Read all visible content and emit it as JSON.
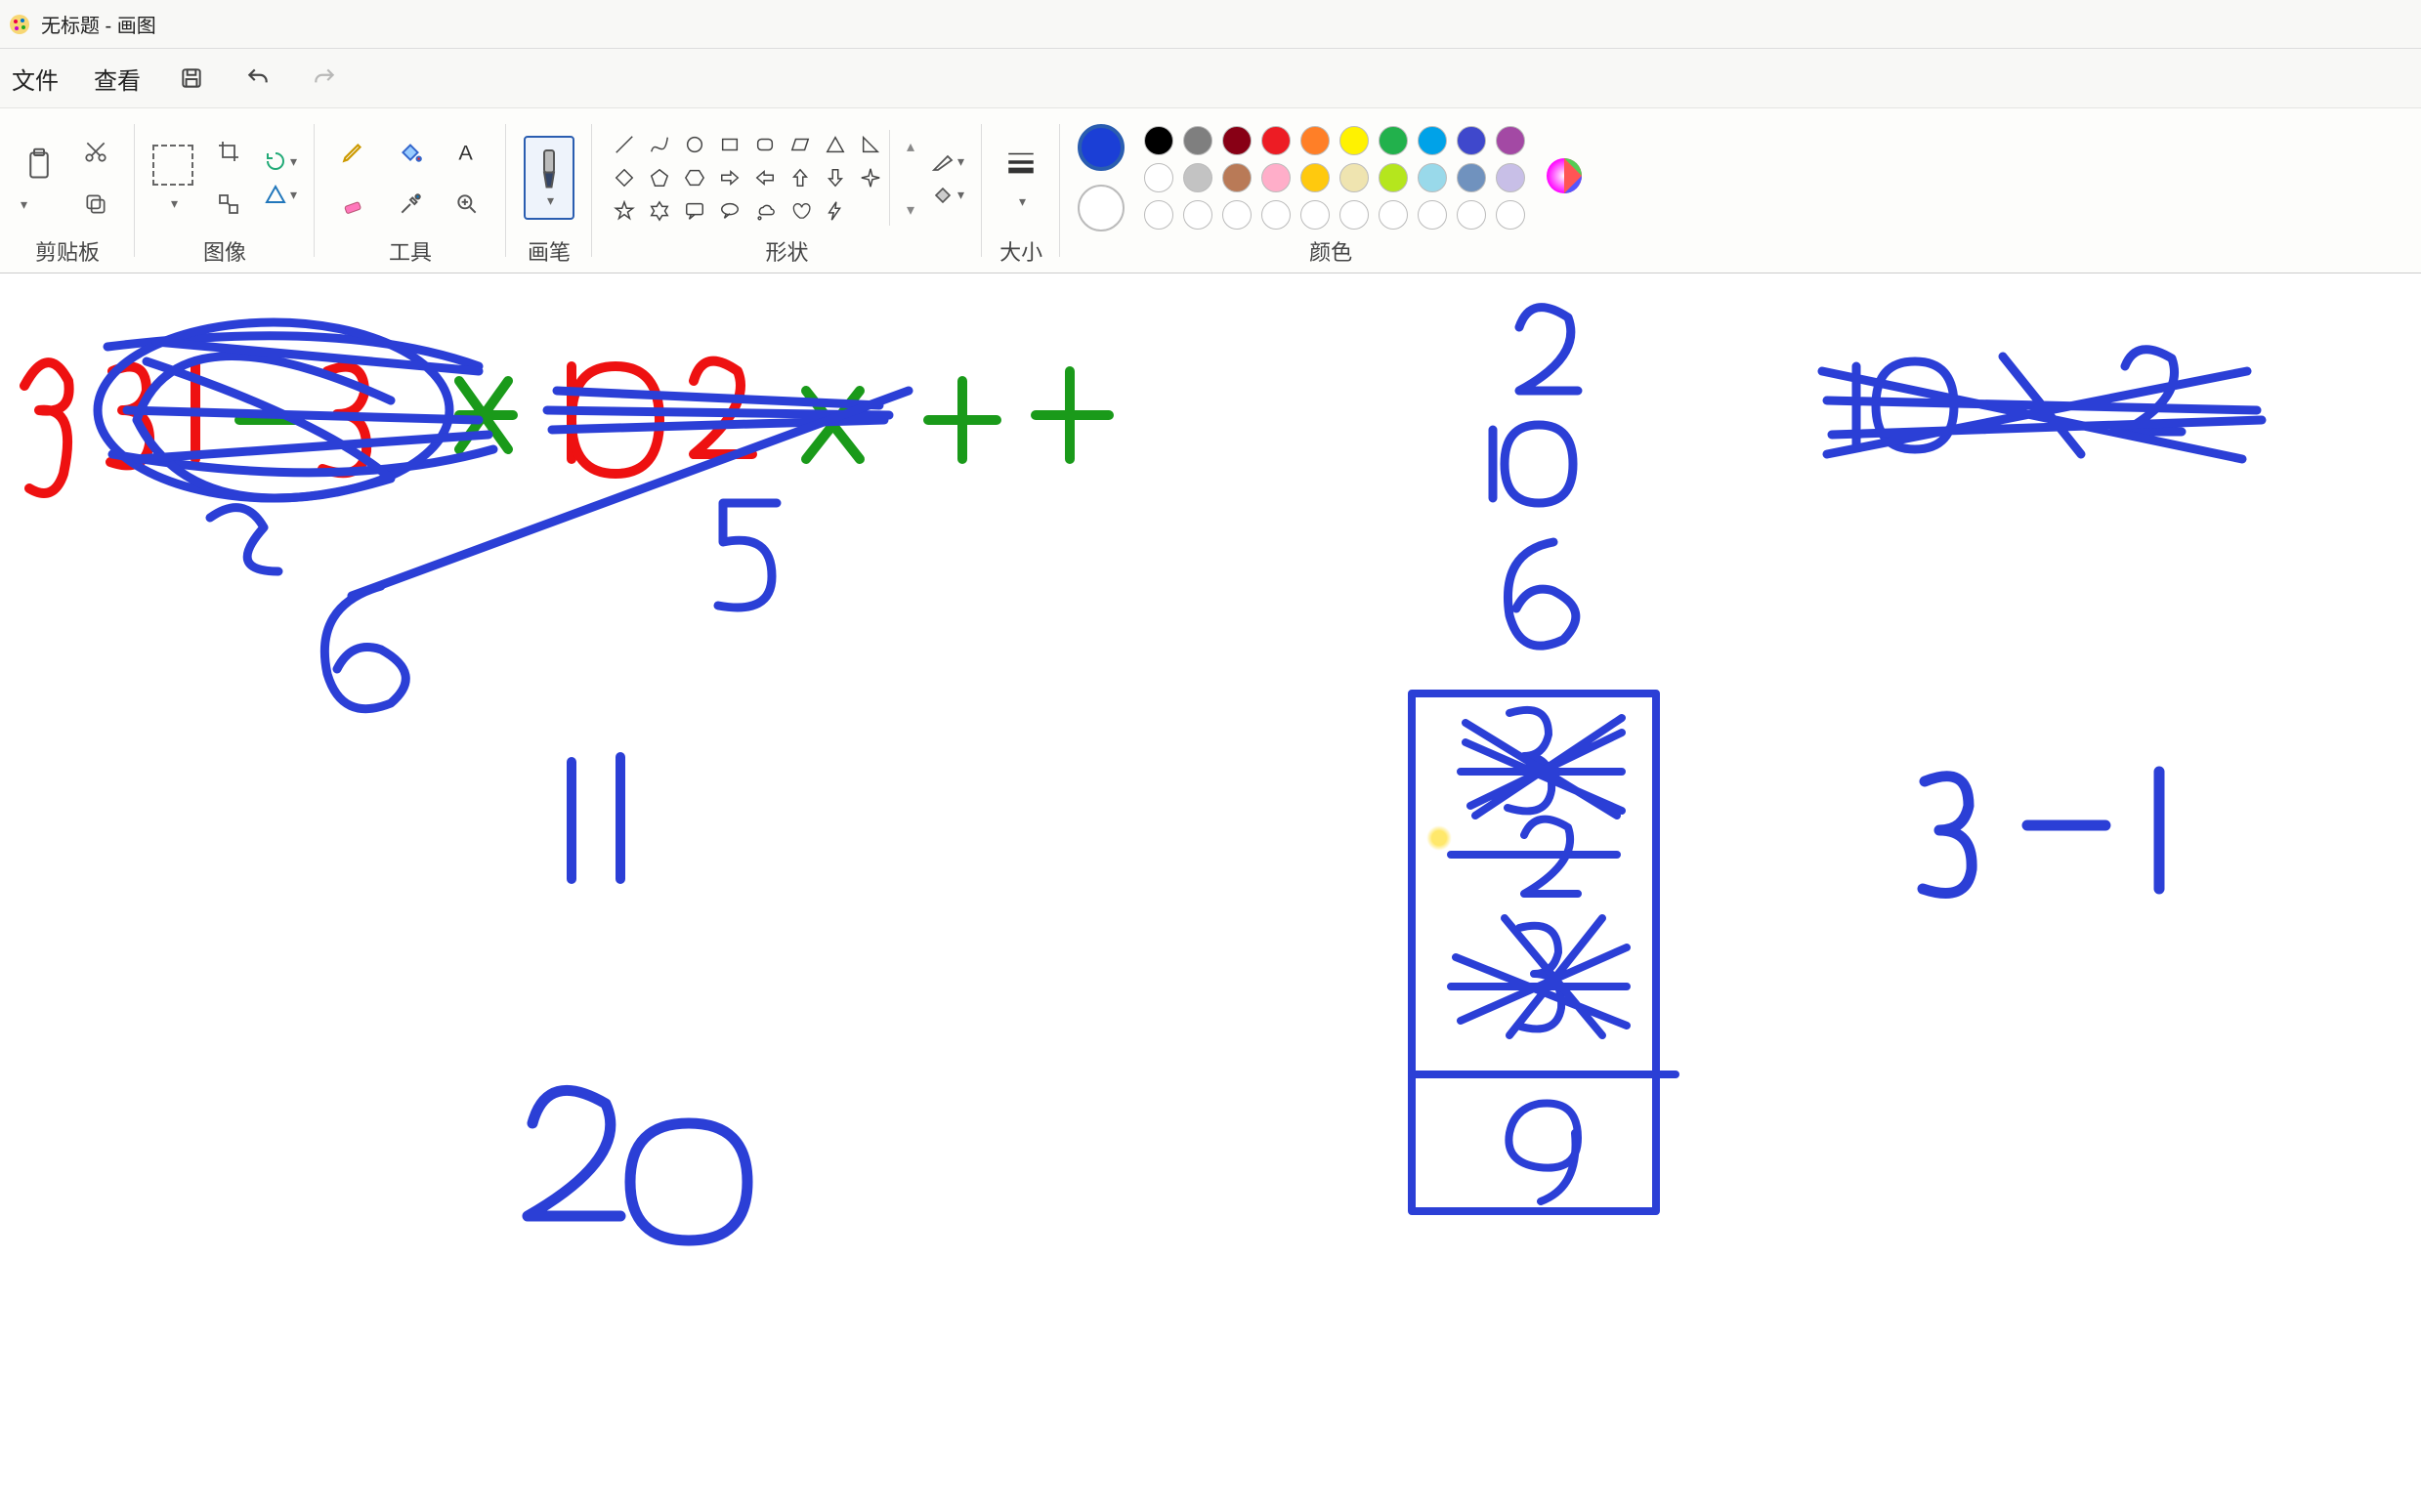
{
  "window": {
    "title": "无标题 - 画图"
  },
  "menu": {
    "file": "文件",
    "view": "查看"
  },
  "groups": {
    "clipboard": "剪贴板",
    "image": "图像",
    "tools": "工具",
    "brushes": "画笔",
    "shapes": "形状",
    "size": "大小",
    "colors": "颜色"
  },
  "colors": {
    "active": "#1b3fd6",
    "secondary": "#ffffff",
    "row1": [
      "#000000",
      "#7f7f7f",
      "#880015",
      "#ed1c24",
      "#ff7f27",
      "#fff200",
      "#22b14c",
      "#00a2e8",
      "#3f48cc",
      "#a349a4"
    ],
    "row2": [
      "#ffffff",
      "#c3c3c3",
      "#b97a57",
      "#ffaec9",
      "#ffc90e",
      "#efe4b0",
      "#b5e61d",
      "#99d9ea",
      "#7092be",
      "#c8bfe7"
    ],
    "row3_empty_count": 10
  },
  "shape_icons": [
    "line",
    "curve",
    "circle",
    "rect",
    "round-rect",
    "parallelogram",
    "triangle",
    "right-triangle",
    "diamond",
    "pentagon",
    "hexagon",
    "arrow-right",
    "arrow-left",
    "arrow-up",
    "arrow-down",
    "four-point-star",
    "five-star",
    "six-star",
    "speech-rect",
    "speech-round",
    "speech-cloud",
    "heart",
    "lightning",
    ""
  ],
  "canvas_note": "freehand drawing content"
}
